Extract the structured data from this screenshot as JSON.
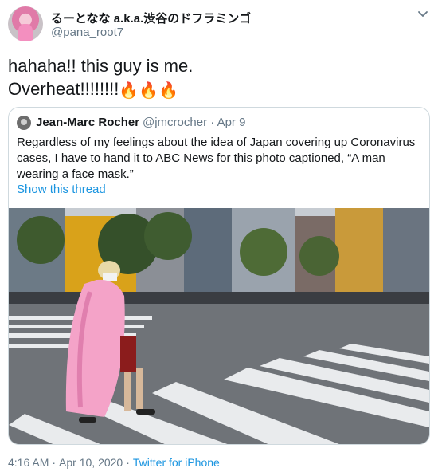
{
  "author": {
    "display_name": "るーとなな a.k.a.渋谷のドフラミンゴ",
    "handle": "@pana_root7"
  },
  "tweet": {
    "line1": "hahaha!! this guy is me.",
    "line2": "Overheat!!!!!!!!",
    "emoji": [
      "🔥",
      "🔥",
      "🔥"
    ]
  },
  "quoted": {
    "name": "Jean-Marc Rocher",
    "handle_date": "@jmcrocher · Apr 9",
    "text": "Regardless of my feelings about the idea of Japan covering up Coronavirus cases, I have to hand it to ABC News for this photo captioned, “A man wearing a face mask.”",
    "show_thread": "Show this thread"
  },
  "footer": {
    "time": "4:16 AM",
    "date": "Apr 10, 2020",
    "separator": "·",
    "source": "Twitter for iPhone"
  },
  "colors": {
    "link": "#1b95e0",
    "secondary_text": "#657786",
    "border": "#cfd9de"
  },
  "icons": {
    "caret": "chevron-down-icon",
    "emoji": "fire-icon"
  }
}
